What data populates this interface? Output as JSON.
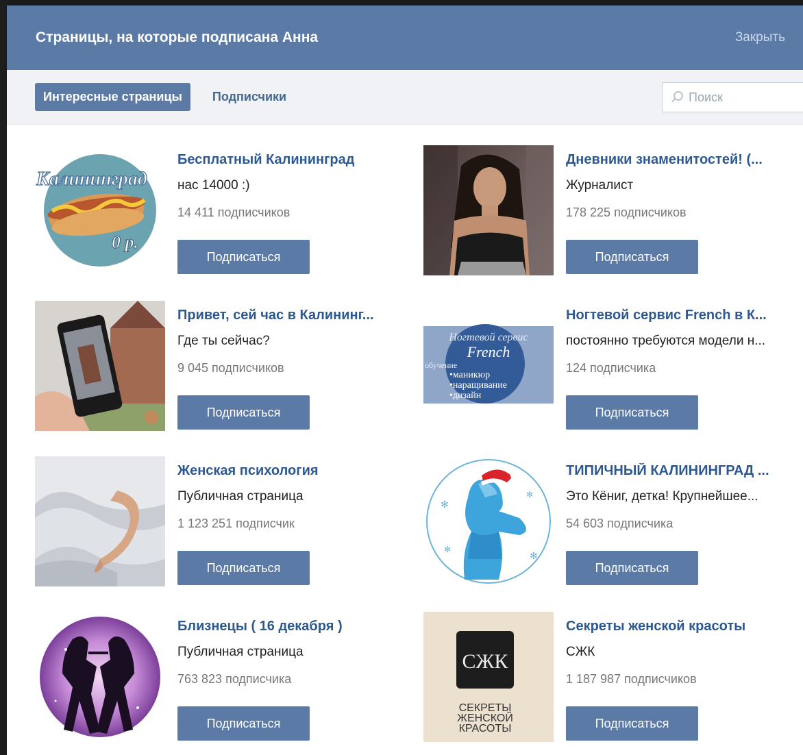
{
  "header": {
    "title": "Страницы, на которые подписана Анна",
    "close_label": "Закрыть"
  },
  "tabs": [
    {
      "label": "Интересные страницы",
      "active": true
    },
    {
      "label": "Подписчики",
      "active": false
    }
  ],
  "search": {
    "placeholder": "Поиск"
  },
  "subscribe_label": "Подписаться",
  "pages": [
    {
      "name": "Бесплатный Калининград",
      "desc": "нас 14000 :)",
      "subs": "14 411 подписчиков",
      "image": "kaliningrad-hotdog-logo",
      "logo_text": "Калининград",
      "logo_text2": "0 р."
    },
    {
      "name": "Дневники знаменитостей! (...",
      "desc": "Журналист",
      "subs": "178 225 подписчиков",
      "image": "celebrity-photo"
    },
    {
      "name": "Привет, сей час в Калининг...",
      "desc": "Где ты сейчас?",
      "subs": "9 045 подписчиков",
      "image": "phone-cathedral-photo"
    },
    {
      "name": "Ногтевой сервис French в К...",
      "desc": "постоянно требуются модели н...",
      "subs": "124 подписчика",
      "image": "nail-service-logo",
      "logo_lines": [
        "Ногтевой сервис",
        "French",
        "обучение",
        "•маникюр",
        "•наращивание",
        "•дизайн"
      ]
    },
    {
      "name": "Женская психология",
      "desc": "Публичная страница",
      "subs": "1 123 251 подписчик",
      "image": "woman-bedsheet-photo"
    },
    {
      "name": "ТИПИЧНЫЙ КАЛИНИНГРАД ...",
      "desc": "Это Кёниг, детка! Крупнейшее...",
      "subs": "54 603 подписчика",
      "image": "typical-kaliningrad-logo"
    },
    {
      "name": "Близнецы ( 16 декабря )",
      "desc": "Публичная страница",
      "subs": "763 823 подписчика",
      "image": "gemini-zodiac-logo"
    },
    {
      "name": "Секреты женской красоты",
      "desc": "СЖК",
      "subs": "1 187 987 подписчиков",
      "image": "beauty-secrets-logo",
      "logo_lines": [
        "СЕКРЕТЫ",
        "ЖЕНСКОЙ",
        "КРАСОТЫ"
      ],
      "logo_mark": "СЖК"
    }
  ],
  "colors": {
    "header_bg": "#5b7ba6",
    "link": "#2d5990",
    "button_bg": "#5b7ba6"
  }
}
